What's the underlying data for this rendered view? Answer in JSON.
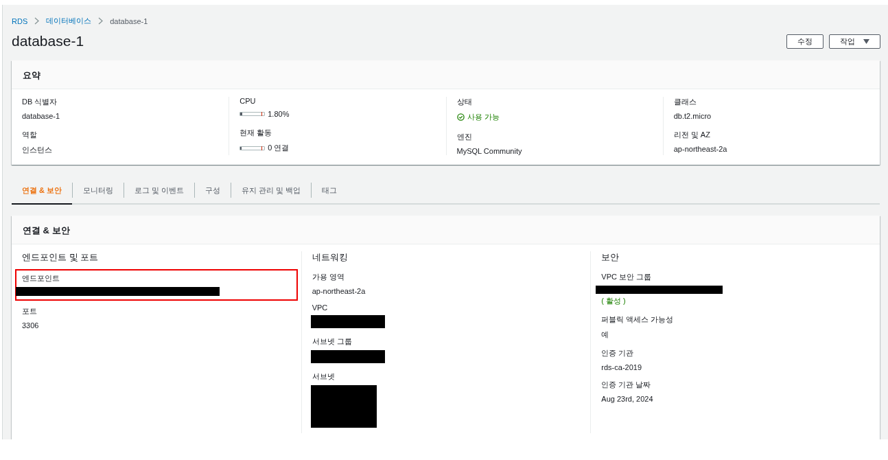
{
  "breadcrumb": [
    {
      "label": "RDS",
      "kind": "link"
    },
    {
      "label": "데이터베이스",
      "kind": "link"
    },
    {
      "label": "database-1",
      "kind": "current"
    }
  ],
  "title": "database-1",
  "buttons": [
    {
      "label": "수정",
      "dropdown": false
    },
    {
      "label": "작업",
      "dropdown": true
    }
  ],
  "summary": {
    "title": "요약",
    "columns": [
      {
        "items": [
          {
            "label": "DB 식별자",
            "kind": "text",
            "value": "database-1"
          },
          {
            "label": "역할",
            "kind": "text",
            "value": "인스턴스"
          }
        ]
      },
      {
        "items": [
          {
            "label": "CPU",
            "kind": "meter",
            "level": 0.018,
            "reading": "1.80%"
          },
          {
            "label": "현재 활동",
            "kind": "meter",
            "level": 0,
            "reading": "0 연결"
          }
        ]
      },
      {
        "items": [
          {
            "label": "상태",
            "kind": "status",
            "value": "사용 가능"
          },
          {
            "label": "엔진",
            "kind": "text",
            "value": "MySQL Community"
          }
        ]
      },
      {
        "items": [
          {
            "label": "클래스",
            "kind": "text",
            "value": "db.t2.micro"
          },
          {
            "label": "리전 및 AZ",
            "kind": "text",
            "value": "ap-northeast-2a"
          }
        ]
      }
    ]
  },
  "tabs": [
    {
      "label": "연결 & 보안",
      "selected": true
    },
    {
      "label": "모니터링",
      "selected": false
    },
    {
      "label": "로그 및 이벤트",
      "selected": false
    },
    {
      "label": "구성",
      "selected": false
    },
    {
      "label": "유지 관리 및 백업",
      "selected": false
    },
    {
      "label": "태그",
      "selected": false
    }
  ],
  "connectivity": {
    "title": "연결 & 보안",
    "sections": [
      {
        "heading": "엔드포인트 및 포트",
        "fields": [
          {
            "label": "엔드포인트",
            "kind": "redacted-wide",
            "highlighted": true
          },
          {
            "label": "포트",
            "kind": "text",
            "value": "3306",
            "highlighted": false
          }
        ]
      },
      {
        "heading": "네트워킹",
        "fields": [
          {
            "label": "가용 영역",
            "kind": "text",
            "value": "ap-northeast-2a",
            "highlighted": false
          },
          {
            "label": "VPC",
            "kind": "redacted",
            "highlighted": false
          },
          {
            "label": "서브넷 그룹",
            "kind": "redacted",
            "highlighted": false
          },
          {
            "label": "서브넷",
            "kind": "redacted-block",
            "highlighted": false
          }
        ]
      },
      {
        "heading": "보안",
        "fields": [
          {
            "label": "VPC 보안 그룹",
            "kind": "redacted-medium",
            "status": "( 활성 )",
            "highlighted": false
          },
          {
            "label": "퍼블릭 액세스 가능성",
            "kind": "text",
            "value": "예",
            "highlighted": false
          },
          {
            "label": "인증 기관",
            "kind": "text",
            "value": "rds-ca-2019",
            "highlighted": false
          },
          {
            "label": "인증 기관 날짜",
            "kind": "text",
            "value": "Aug 23rd, 2024",
            "highlighted": false
          }
        ]
      }
    ]
  }
}
